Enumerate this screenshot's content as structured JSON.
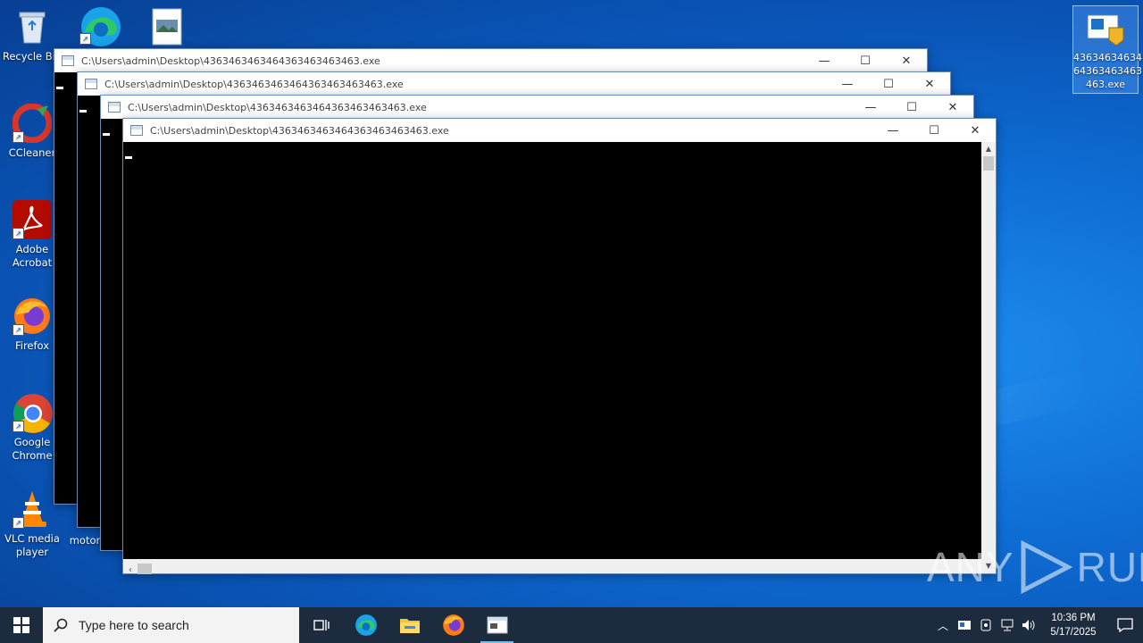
{
  "desktop": {
    "icons": [
      {
        "label": "Recycle Bin"
      },
      {
        "label": "CCleaner"
      },
      {
        "label": "Adobe Acrobat"
      },
      {
        "label": "Firefox"
      },
      {
        "label": "Google Chrome"
      },
      {
        "label": "VLC media player"
      },
      {
        "label": "motor"
      },
      {
        "label": "43634634634 64363463463 463.exe"
      }
    ]
  },
  "windows": [
    {
      "title": "C:\\Users\\admin\\Desktop\\4363463463464363463463463.exe"
    },
    {
      "title": "C:\\Users\\admin\\Desktop\\4363463463464363463463463.exe"
    },
    {
      "title": "C:\\Users\\admin\\Desktop\\4363463463464363463463463.exe"
    },
    {
      "title": "C:\\Users\\admin\\Desktop\\4363463463464363463463463.exe"
    }
  ],
  "taskbar": {
    "search_placeholder": "Type here to search",
    "time": "10:36 PM",
    "date": "5/17/2025"
  },
  "watermark": {
    "text_left": "ANY",
    "text_right": "RUN"
  },
  "colors": {
    "desktop": "#0f6fd6",
    "taskbar": "#1c2b3d",
    "console": "#000000"
  }
}
